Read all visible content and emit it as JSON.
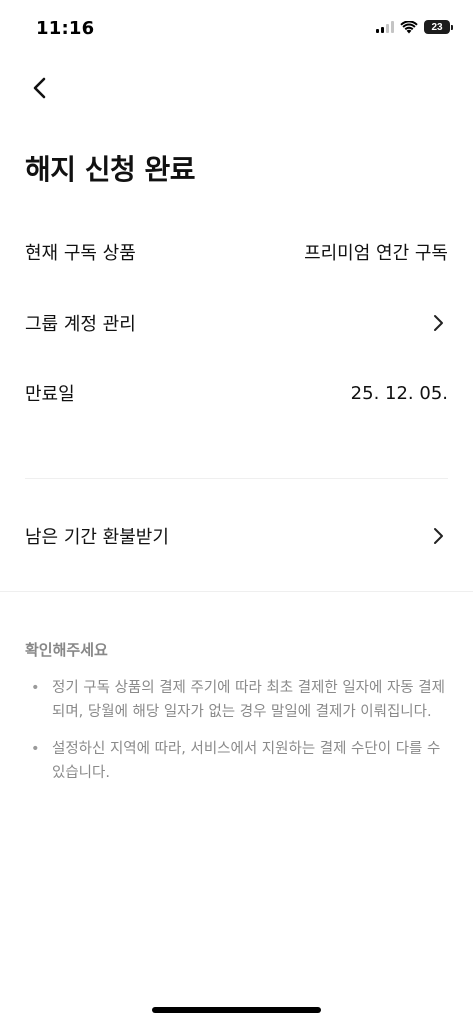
{
  "status_bar": {
    "time": "11:16",
    "battery_level": "23"
  },
  "header": {
    "title": "해지 신청 완료"
  },
  "rows": {
    "current_product_label": "현재 구독 상품",
    "current_product_value": "프리미엄 연간 구독",
    "group_account_label": "그룹 계정 관리",
    "expiry_label": "만료일",
    "expiry_value": "25. 12. 05.",
    "refund_label": "남은 기간 환불받기"
  },
  "notice": {
    "title": "확인해주세요",
    "items": [
      "정기 구독 상품의 결제 주기에 따라 최초 결제한 일자에 자동 결제되며, 당월에 해당 일자가 없는 경우 말일에 결제가 이뤄집니다.",
      "설정하신 지역에 따라, 서비스에서 지원하는 결제 수단이 다를 수 있습니다."
    ],
    "bullet": "•"
  },
  "icons": {
    "back": "chevron-left-icon",
    "row_arrow": "chevron-right-icon",
    "signal": "cellular-signal-icon",
    "wifi": "wifi-icon",
    "battery": "battery-icon"
  },
  "colors": {
    "text_primary": "#111111",
    "text_secondary": "#8a8a8a",
    "divider": "#efefef",
    "background": "#ffffff"
  }
}
